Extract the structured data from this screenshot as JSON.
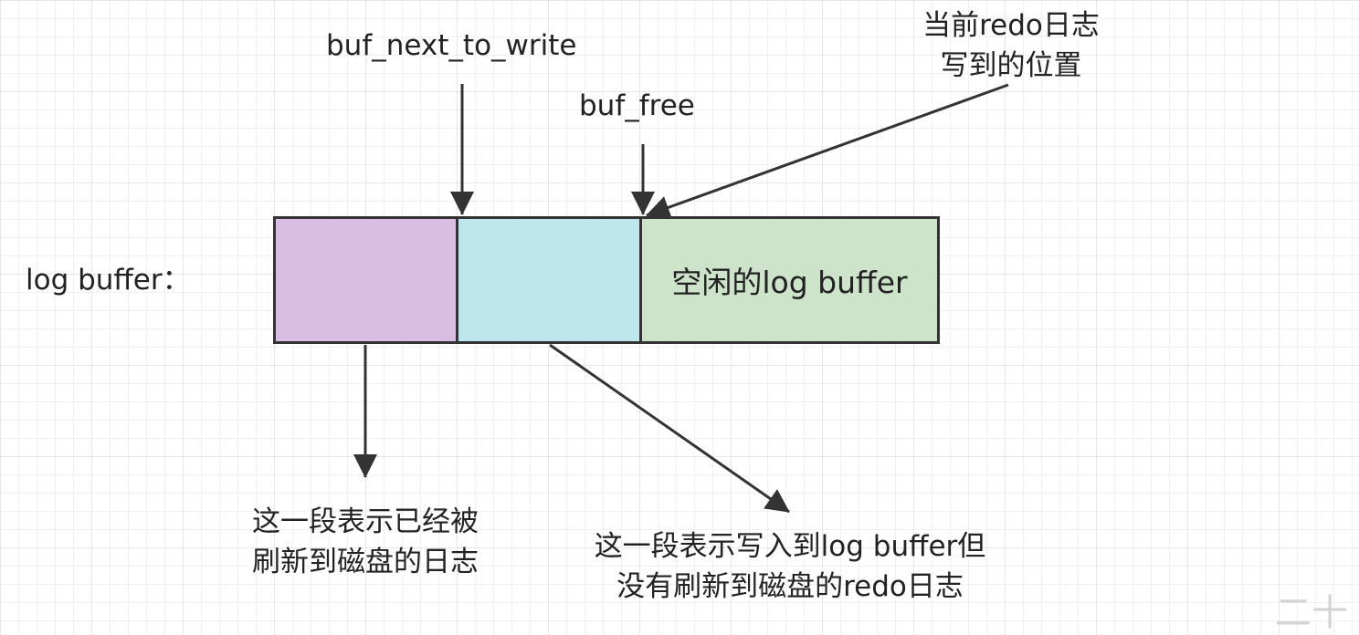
{
  "diagram": {
    "buffer_label": "log buffer：",
    "pointer_next_to_write": "buf_next_to_write",
    "pointer_free": "buf_free",
    "current_write_position": [
      "当前redo日志",
      "写到的位置"
    ],
    "free_segment_label": "空闲的log buffer",
    "flushed_note": [
      "这一段表示已经被",
      "刷新到磁盘的日志"
    ],
    "unflushed_note": [
      "这一段表示写入到log buffer但",
      "没有刷新到磁盘的redo日志"
    ],
    "watermark": "二十",
    "colors": {
      "flushed_segment": "#d9bde3",
      "unflushed_segment": "#bde6ed",
      "free_segment": "#cde4ca",
      "stroke": "#333333"
    }
  }
}
